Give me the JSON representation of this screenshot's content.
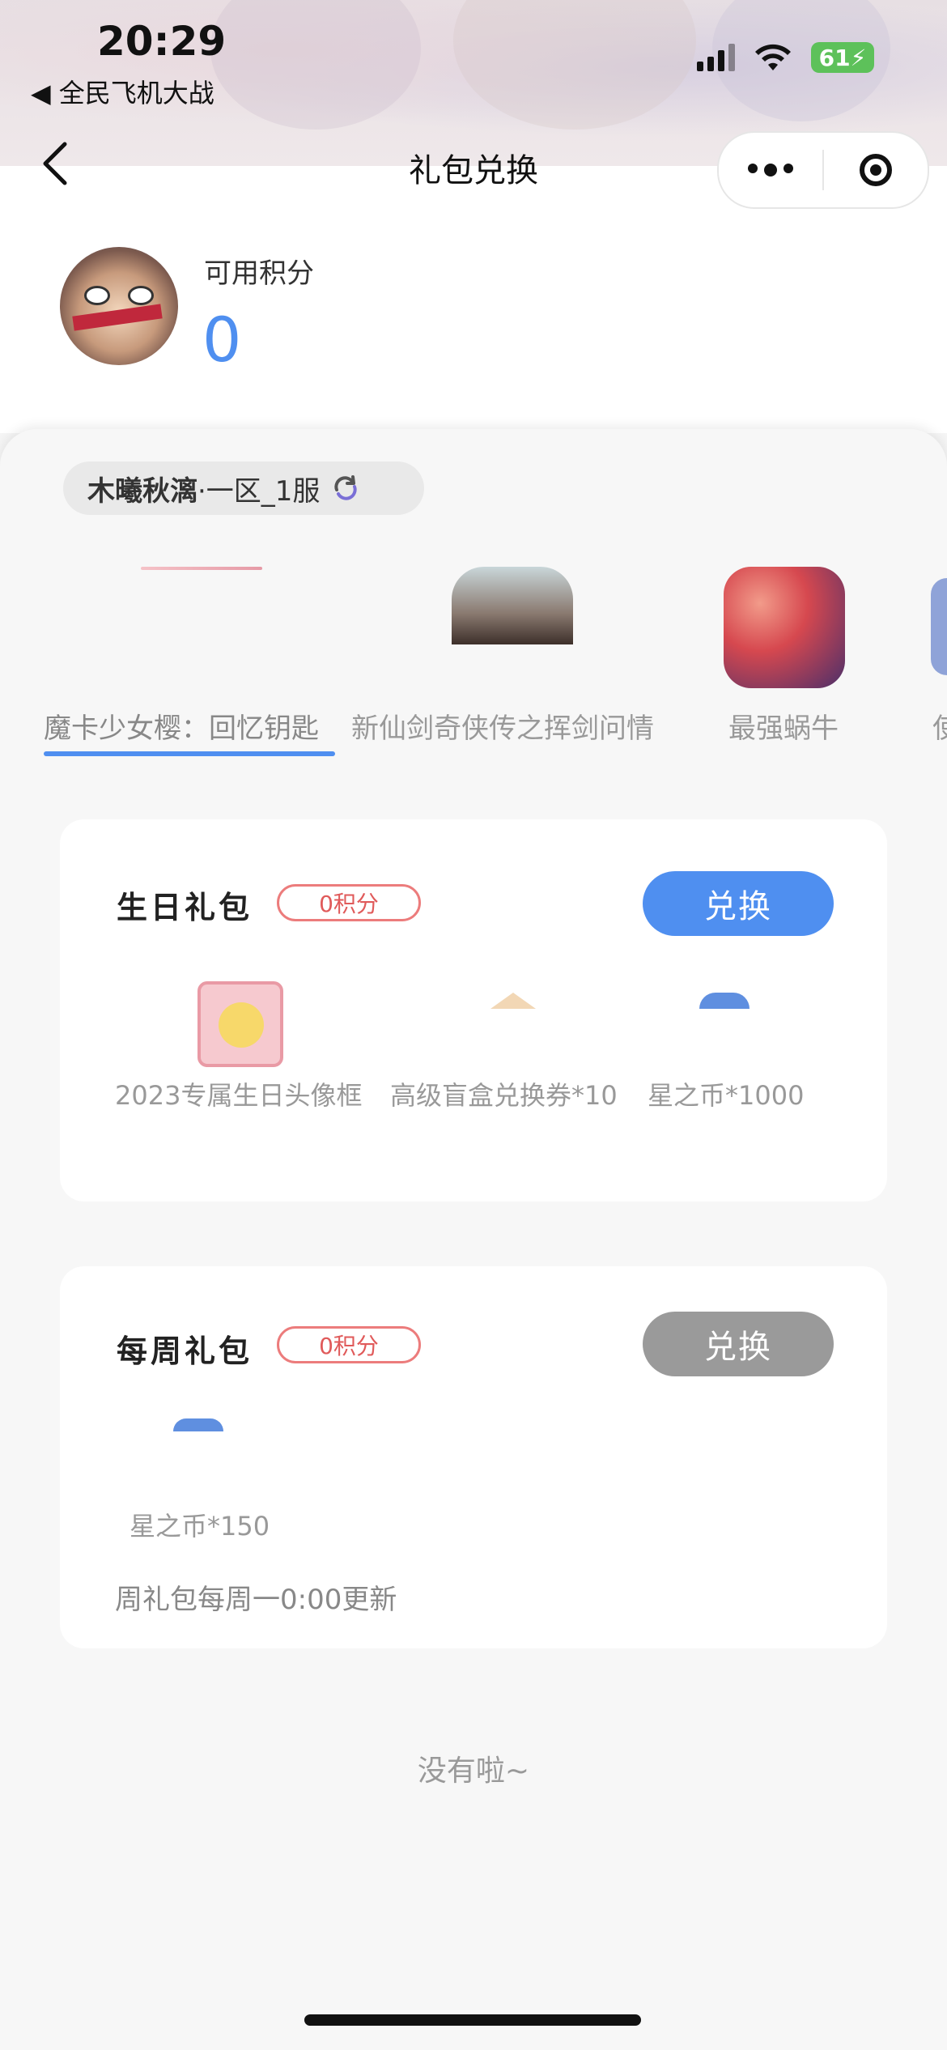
{
  "status_bar": {
    "time": "20:29",
    "back_app": "◀ 全民飞机大战",
    "battery": "61"
  },
  "navbar": {
    "title": "礼包兑换"
  },
  "header": {
    "points_label": "可用积分",
    "points_value": "0"
  },
  "server": {
    "name": "木曦秋漓",
    "zone": "·一区_1服"
  },
  "games": [
    {
      "label": "魔卡少女樱：回忆钥匙",
      "selected": true
    },
    {
      "label": "新仙剑奇侠传之挥剑问情",
      "selected": false
    },
    {
      "label": "最强蜗牛",
      "selected": false
    },
    {
      "label": "使",
      "selected": false
    }
  ],
  "packs": [
    {
      "title": "生日礼包",
      "points": "0积分",
      "button": "兑换",
      "button_color": "#4f8ff0",
      "items": [
        "2023专属生日头像框",
        "高级盲盒兑换券*10",
        "星之币*1000"
      ]
    },
    {
      "title": "每周礼包",
      "points": "0积分",
      "button": "兑换",
      "button_color": "#9a9a9a",
      "items": [
        "星之币*150"
      ],
      "note": "周礼包每周一0:00更新"
    }
  ],
  "end_text": "没有啦~",
  "colors": {
    "accent": "#4f8ff0",
    "badge": "#ec7c7c",
    "disabled": "#9a9a9a"
  }
}
